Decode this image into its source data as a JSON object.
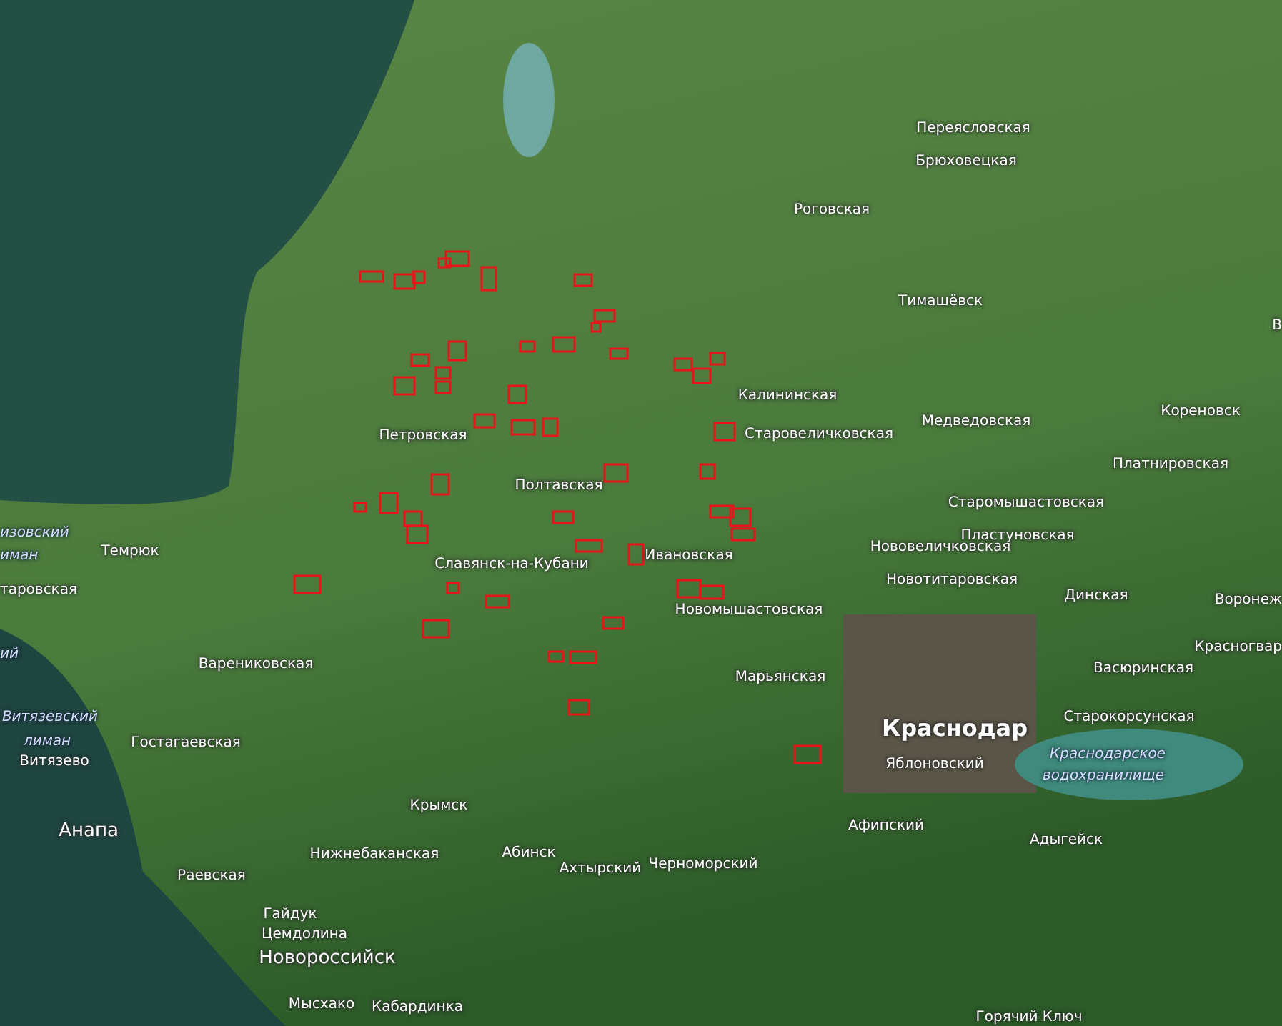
{
  "map": {
    "labels": [
      {
        "text": "Переясловская",
        "kind": "town"
      },
      {
        "text": "Брюховецкая",
        "kind": "town"
      },
      {
        "text": "Роговская",
        "kind": "town"
      },
      {
        "text": "Тимашёвск",
        "kind": "town"
      },
      {
        "text": "Калининская",
        "kind": "town"
      },
      {
        "text": "Старовеличковская",
        "kind": "town"
      },
      {
        "text": "Медведовская",
        "kind": "town"
      },
      {
        "text": "Кореновск",
        "kind": "town"
      },
      {
        "text": "В",
        "kind": "town"
      },
      {
        "text": "Платнировская",
        "kind": "town"
      },
      {
        "text": "Петровская",
        "kind": "town"
      },
      {
        "text": "Полтавская",
        "kind": "town"
      },
      {
        "text": "Старомышастовская",
        "kind": "town"
      },
      {
        "text": "Пластуновская",
        "kind": "town"
      },
      {
        "text": "Нововеличковская",
        "kind": "town"
      },
      {
        "text": "Славянск-на-Кубани",
        "kind": "town"
      },
      {
        "text": "Ивановская",
        "kind": "town"
      },
      {
        "text": "Новотитаровская",
        "kind": "town"
      },
      {
        "text": "Динская",
        "kind": "town"
      },
      {
        "text": "Новомышастовская",
        "kind": "town"
      },
      {
        "text": "Воронеж",
        "kind": "town"
      },
      {
        "text": "Красногвар",
        "kind": "town"
      },
      {
        "text": "Васюринская",
        "kind": "town"
      },
      {
        "text": "Марьянская",
        "kind": "town"
      },
      {
        "text": "Старокорсунская",
        "kind": "town"
      },
      {
        "text": "Краснодар",
        "kind": "city"
      },
      {
        "text": "Яблоновский",
        "kind": "town"
      },
      {
        "text": "Краснодарское",
        "kind": "water"
      },
      {
        "text": "водохранилище",
        "kind": "water"
      },
      {
        "text": "изовский",
        "kind": "water"
      },
      {
        "text": "иман",
        "kind": "water"
      },
      {
        "text": "Темрюк",
        "kind": "town"
      },
      {
        "text": "таровская",
        "kind": "town"
      },
      {
        "text": "ий",
        "kind": "water"
      },
      {
        "text": "Варениковская",
        "kind": "town"
      },
      {
        "text": "Витязевский",
        "kind": "water"
      },
      {
        "text": "лиман",
        "kind": "water"
      },
      {
        "text": "Гостагаевская",
        "kind": "town"
      },
      {
        "text": "Витязево",
        "kind": "town"
      },
      {
        "text": "Крымск",
        "kind": "town"
      },
      {
        "text": "Афипский",
        "kind": "town"
      },
      {
        "text": "Анапа",
        "kind": "major"
      },
      {
        "text": "Адыгейск",
        "kind": "town"
      },
      {
        "text": "Абинск",
        "kind": "town"
      },
      {
        "text": "Нижнебаканская",
        "kind": "town"
      },
      {
        "text": "Ахтырский",
        "kind": "town"
      },
      {
        "text": "Черноморский",
        "kind": "town"
      },
      {
        "text": "Раевская",
        "kind": "town"
      },
      {
        "text": "Гайдук",
        "kind": "town"
      },
      {
        "text": "Цемдолина",
        "kind": "town"
      },
      {
        "text": "Новороссийск",
        "kind": "major"
      },
      {
        "text": "Мысхако",
        "kind": "town"
      },
      {
        "text": "Кабардинка",
        "kind": "town"
      },
      {
        "text": "Горячий Ключ",
        "kind": "town"
      }
    ]
  }
}
